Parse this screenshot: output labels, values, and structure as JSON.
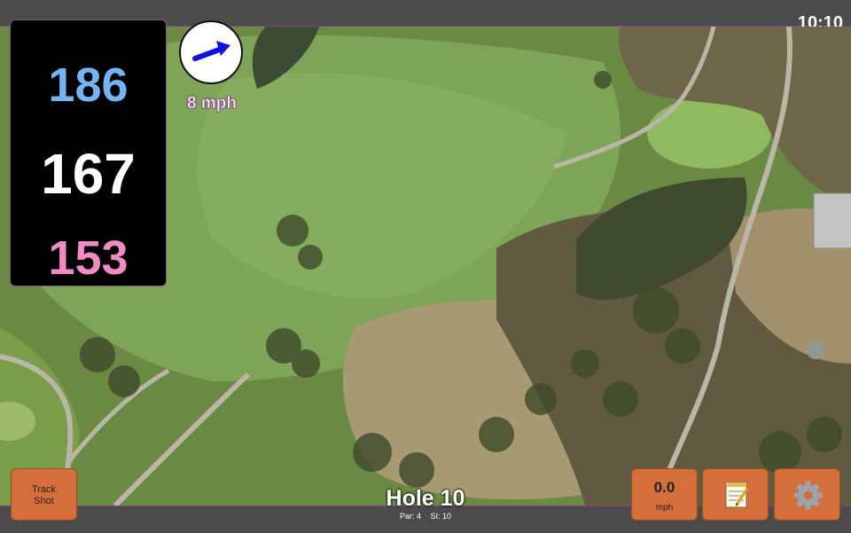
{
  "status": {
    "time": "10:10"
  },
  "distances": {
    "back": "186",
    "middle": "167",
    "front": "153"
  },
  "wind": {
    "speed": "8 mph",
    "icon": "wind-arrow-icon"
  },
  "hole": {
    "title": "Hole 10",
    "par": "Par: 4",
    "si": "SI: 10"
  },
  "buttons": {
    "track_line1": "Track",
    "track_line2": "Shot",
    "speed_value": "0.0",
    "speed_unit": "mph",
    "notes_icon": "notepad-icon",
    "settings_icon": "gear-icon"
  },
  "colors": {
    "back": "#74b4f3",
    "middle": "#ffffff",
    "front": "#f28ac6",
    "button": "#d46f3b",
    "accent": "#8a3f86"
  }
}
